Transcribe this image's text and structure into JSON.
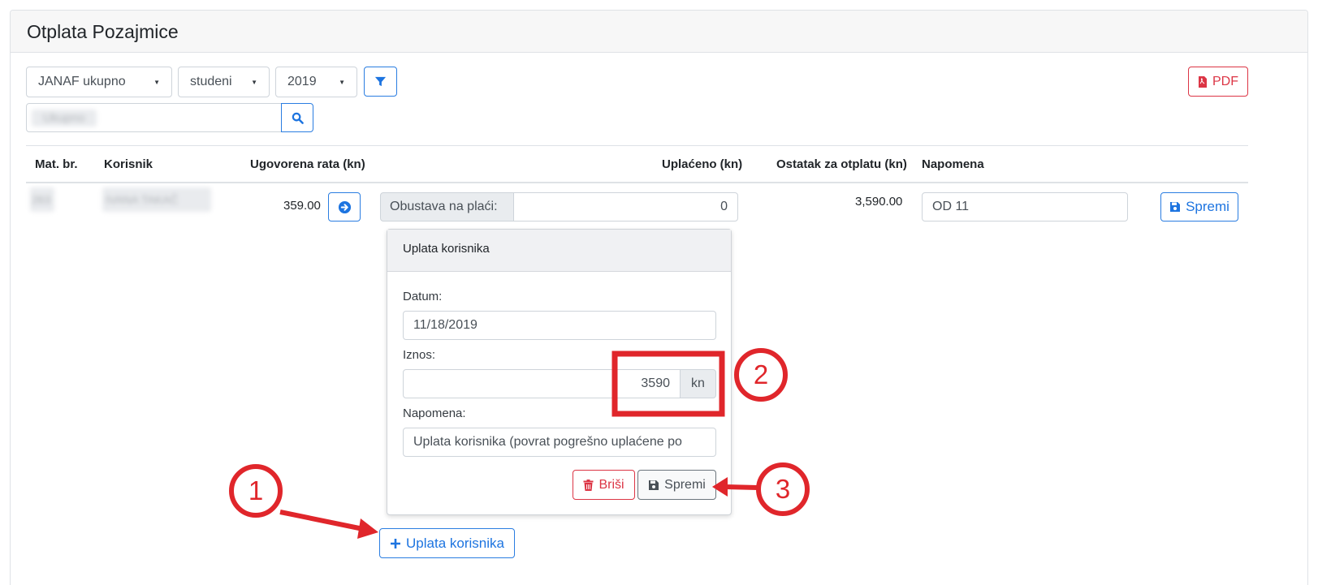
{
  "header": {
    "title": "Otplata Pozajmice"
  },
  "filters": {
    "company": "JANAF ukupno",
    "month": "studeni",
    "year": "2019",
    "pdf_label": "PDF",
    "search_value": "Ukupno"
  },
  "table": {
    "headers": [
      "Mat. br.",
      "Korisnik",
      "Ugovorena rata (kn)",
      "Uplaćeno (kn)",
      "Ostatak za otplatu (kn)",
      "Napomena"
    ],
    "row": {
      "mat_br": "263",
      "korisnik": "IVANA TAKAČ",
      "rata": "359.00",
      "obustava_label": "Obustava na plaći:",
      "uplaceno": "0",
      "ostatak": "3,590.00",
      "napomena": "OD 11",
      "save_label": "Spremi"
    }
  },
  "popover": {
    "title": "Uplata korisnika",
    "datum_label": "Datum:",
    "datum_value": "11/18/2019",
    "iznos_label": "Iznos:",
    "iznos_value": "3590",
    "iznos_unit": "kn",
    "napomena_label": "Napomena:",
    "napomena_value": "Uplata korisnika (povrat pogrešno uplaćene po",
    "delete_label": "Briši",
    "save_label": "Spremi"
  },
  "add_payment_label": "Uplata korisnika",
  "annotations": {
    "step1": "1",
    "step2": "2",
    "step3": "3"
  },
  "colors": {
    "accent": "#1d74e0",
    "danger": "#dc3545",
    "annotation": "#e0262b"
  }
}
